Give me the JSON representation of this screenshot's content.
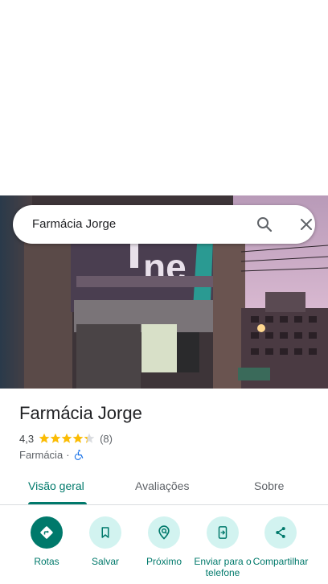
{
  "search": {
    "query": "Farmácia Jorge",
    "search_icon": "search-icon",
    "close_icon": "close-icon"
  },
  "place": {
    "name": "Farmácia Jorge",
    "rating": "4,3",
    "rating_stars": 4.3,
    "review_count": "(8)",
    "category": "Farmácia",
    "separator": "·",
    "accessibility_icon": "wheelchair-icon"
  },
  "tabs": [
    {
      "label": "Visão geral",
      "active": true
    },
    {
      "label": "Avaliações",
      "active": false
    },
    {
      "label": "Sobre",
      "active": false
    }
  ],
  "actions": [
    {
      "label": "Rotas",
      "icon": "directions-icon"
    },
    {
      "label": "Salvar",
      "icon": "bookmark-icon"
    },
    {
      "label": "Próximo",
      "icon": "nearby-icon"
    },
    {
      "label": "Enviar para o telefone",
      "icon": "send-to-phone-icon"
    },
    {
      "label": "Compartilhar",
      "icon": "share-icon"
    }
  ],
  "colors": {
    "accent": "#00796b",
    "accent_light": "#d2f3f0",
    "star": "#fbbc04"
  }
}
